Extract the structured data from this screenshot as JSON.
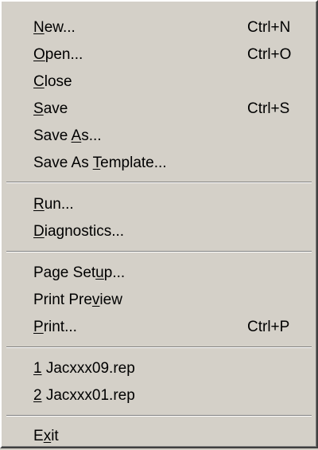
{
  "menu": {
    "new": {
      "mnemonic": "N",
      "rest": "ew...",
      "shortcut": "Ctrl+N"
    },
    "open": {
      "mnemonic": "O",
      "rest": "pen...",
      "shortcut": "Ctrl+O"
    },
    "close": {
      "mnemonic": "C",
      "rest": "lose"
    },
    "save": {
      "mnemonic": "S",
      "rest": "ave",
      "shortcut": "Ctrl+S"
    },
    "save_as": {
      "pre": "Save ",
      "mnemonic": "A",
      "rest": "s..."
    },
    "save_as_template": {
      "pre": "Save As ",
      "mnemonic": "T",
      "rest": "emplate..."
    },
    "run": {
      "mnemonic": "R",
      "rest": "un..."
    },
    "diagnostics": {
      "mnemonic": "D",
      "rest": "iagnostics..."
    },
    "page_setup": {
      "pre": "Page Set",
      "mnemonic": "u",
      "rest": "p..."
    },
    "print_preview": {
      "pre": "Print Pre",
      "mnemonic": "v",
      "rest": "iew"
    },
    "print": {
      "mnemonic": "P",
      "rest": "rint...",
      "shortcut": "Ctrl+P"
    },
    "recent1": {
      "mnemonic": "1",
      "rest": " Jacxxx09.rep"
    },
    "recent2": {
      "mnemonic": "2",
      "rest": " Jacxxx01.rep"
    },
    "exit": {
      "pre": "E",
      "mnemonic": "x",
      "rest": "it"
    }
  }
}
